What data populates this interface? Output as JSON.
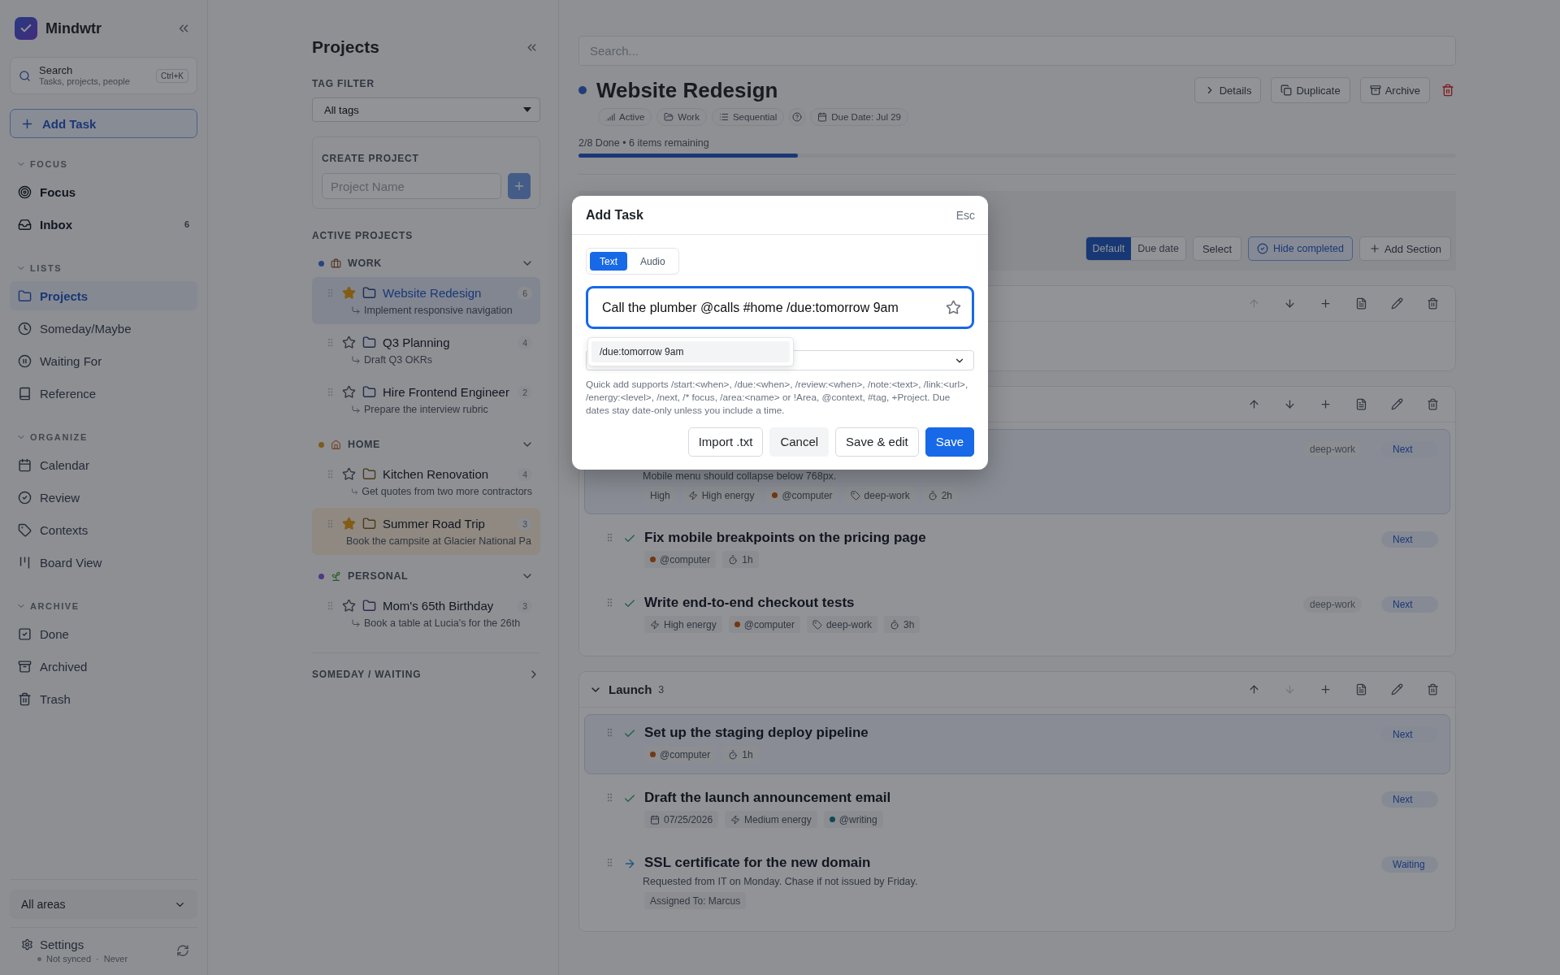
{
  "sidebar": {
    "app_name": "Mindwtr",
    "search": {
      "label": "Search",
      "hint": "Tasks, projects, people",
      "shortcut": "Ctrl+K"
    },
    "add_task": "Add Task",
    "groups": [
      {
        "label": "FOCUS",
        "expanded": true,
        "items": [
          {
            "label": "Focus",
            "strong": true,
            "selected": false
          },
          {
            "label": "Inbox",
            "strong": true,
            "selected": false,
            "count": "6"
          }
        ]
      },
      {
        "label": "LISTS",
        "expanded": true,
        "items": [
          {
            "label": "Projects",
            "strong": false,
            "selected": true
          },
          {
            "label": "Someday/Maybe",
            "strong": false,
            "selected": false
          },
          {
            "label": "Waiting For",
            "strong": false,
            "selected": false
          },
          {
            "label": "Reference",
            "strong": false,
            "selected": false
          }
        ]
      },
      {
        "label": "ORGANIZE",
        "expanded": true,
        "items": [
          {
            "label": "Calendar",
            "strong": false,
            "selected": false
          },
          {
            "label": "Review",
            "strong": false,
            "selected": false
          },
          {
            "label": "Contexts",
            "strong": false,
            "selected": false
          },
          {
            "label": "Board View",
            "strong": false,
            "selected": false
          }
        ]
      },
      {
        "label": "ARCHIVE",
        "expanded": true,
        "items": [
          {
            "label": "Done",
            "strong": false,
            "selected": false
          },
          {
            "label": "Archived",
            "strong": false,
            "selected": false
          },
          {
            "label": "Trash",
            "strong": false,
            "selected": false
          }
        ]
      }
    ],
    "area_filter": "All areas",
    "settings": "Settings",
    "sync_status": "Not synced",
    "sync_separator": "·",
    "sync_time": "Never"
  },
  "projects_panel": {
    "title": "Projects",
    "tag_filter_label": "TAG FILTER",
    "tag_filter": "All tags",
    "create_label": "CREATE PROJECT",
    "name_placeholder": "Project Name",
    "active_label": "ACTIVE PROJECTS",
    "areas": [
      {
        "name": "WORK",
        "color": "#28457f",
        "expanded": true,
        "projects": [
          {
            "name": "Website Redesign",
            "count": "6",
            "next": "Implement responsive navigation",
            "starred": true,
            "selected": true,
            "highlighted": false
          },
          {
            "name": "Q3 Planning",
            "count": "4",
            "next": "Draft Q3 OKRs",
            "starred": false,
            "selected": false,
            "highlighted": false
          },
          {
            "name": "Hire Frontend Engineer",
            "count": "2",
            "next": "Prepare the interview rubric",
            "starred": false,
            "selected": false,
            "highlighted": false
          }
        ]
      },
      {
        "name": "HOME",
        "color": "#7e5c1c",
        "expanded": true,
        "projects": [
          {
            "name": "Kitchen Renovation",
            "count": "4",
            "next": "Get quotes from two more contractors",
            "starred": false,
            "selected": false,
            "highlighted": false
          },
          {
            "name": "Summer Road Trip",
            "count": "3",
            "next": "Book the campsite at Glacier National Pa",
            "starred": true,
            "selected": false,
            "highlighted": true
          }
        ]
      },
      {
        "name": "PERSONAL",
        "color": "#4b3b85",
        "expanded": true,
        "projects": [
          {
            "name": "Mom's 65th Birthday",
            "count": "3",
            "next": "Book a table at Lucia's for the 26th",
            "starred": false,
            "selected": false,
            "highlighted": false
          }
        ]
      }
    ],
    "someday_label": "SOMEDAY / WAITING"
  },
  "main": {
    "search_placeholder": "Search...",
    "project": {
      "title": "Website Redesign",
      "chips": [
        {
          "kind": "status",
          "label": "Active"
        },
        {
          "kind": "area",
          "label": "Work"
        },
        {
          "kind": "mode",
          "label": "Sequential"
        },
        {
          "kind": "help"
        },
        {
          "kind": "due",
          "label": "Due Date: Jul 29"
        }
      ],
      "actions": [
        "Details",
        "Duplicate",
        "Archive"
      ],
      "progress": "2/8 Done • 6 items remaining",
      "level": 0.25
    },
    "toolbar": {
      "sort": [
        {
          "label": "Default",
          "selected": true
        },
        {
          "label": "Due date",
          "selected": false
        }
      ],
      "select": "Select",
      "hide_completed": {
        "label": "Hide completed",
        "on": true
      },
      "add_section": "Add Section"
    },
    "sections": [
      {
        "can_move_up": false,
        "can_move_down": true
      },
      {
        "can_move_up": true,
        "can_move_down": true,
        "tasks": [
          {
            "kind": "next",
            "selected": true,
            "description": "Mobile menu should collapse below 768px.",
            "chips": [
              {
                "kind": "priority",
                "label": "High"
              },
              {
                "kind": "energy",
                "label": "High energy"
              },
              {
                "kind": "context",
                "label": "@computer",
                "color": "#713813"
              },
              {
                "kind": "tag",
                "label": "deep-work"
              },
              {
                "kind": "time",
                "label": "2h"
              }
            ],
            "tag_label": "deep-work",
            "status": "Next"
          },
          {
            "kind": "next",
            "selected": false,
            "title": "Fix mobile breakpoints on the pricing page",
            "chips": [
              {
                "kind": "context",
                "label": "@computer",
                "color": "#713813"
              },
              {
                "kind": "time",
                "label": "1h"
              }
            ],
            "status": "Next"
          },
          {
            "kind": "next",
            "selected": false,
            "title": "Write end-to-end checkout tests",
            "chips": [
              {
                "kind": "energy",
                "label": "High energy"
              },
              {
                "kind": "context",
                "label": "@computer",
                "color": "#713813"
              },
              {
                "kind": "tag",
                "label": "deep-work"
              },
              {
                "kind": "time",
                "label": "3h"
              }
            ],
            "tag_label": "deep-work",
            "status": "Next"
          }
        ]
      },
      {
        "title": "Launch",
        "count": "3",
        "expanded": true,
        "can_move_up": true,
        "can_move_down": false,
        "tasks": [
          {
            "kind": "next",
            "selected": true,
            "title": "Set up the staging deploy pipeline",
            "chips": [
              {
                "kind": "context",
                "label": "@computer",
                "color": "#713813"
              },
              {
                "kind": "time",
                "label": "1h"
              }
            ],
            "status": "Next"
          },
          {
            "kind": "next",
            "selected": false,
            "title": "Draft the launch announcement email",
            "chips": [
              {
                "kind": "date",
                "label": "07/25/2026"
              },
              {
                "kind": "energy",
                "label": "Medium energy"
              },
              {
                "kind": "context",
                "label": "@writing",
                "color": "#10485a"
              }
            ],
            "status": "Next"
          },
          {
            "kind": "waiting",
            "selected": false,
            "title": "SSL certificate for the new domain",
            "description": "Requested from IT on Monday. Chase if not issued by Friday.",
            "chips": [
              {
                "kind": "assignee",
                "label": "Assigned To: Marcus"
              }
            ],
            "status": "Waiting"
          }
        ]
      }
    ]
  },
  "modal": {
    "title": "Add Task",
    "esc": "Esc",
    "tabs": [
      {
        "label": "Text",
        "selected": true
      },
      {
        "label": "Audio",
        "selected": false
      }
    ],
    "value": "Call the plumber @calls #home /due:tomorrow 9am",
    "suggestion": "/due:tomorrow 9am",
    "help": "Quick add supports /start:<when>, /due:<when>, /review:<when>, /note:<text>, /link:<url>, /energy:<level>, /next, /* focus, /area:<name> or !Area, @context, #tag, +Project. Due dates stay date-only unless you include a time.",
    "buttons": [
      {
        "label": "Import .txt",
        "kind": "outline"
      },
      {
        "label": "Cancel",
        "kind": "ghost"
      },
      {
        "label": "Save & edit",
        "kind": "outline"
      },
      {
        "label": "Save",
        "kind": "primary"
      }
    ]
  }
}
